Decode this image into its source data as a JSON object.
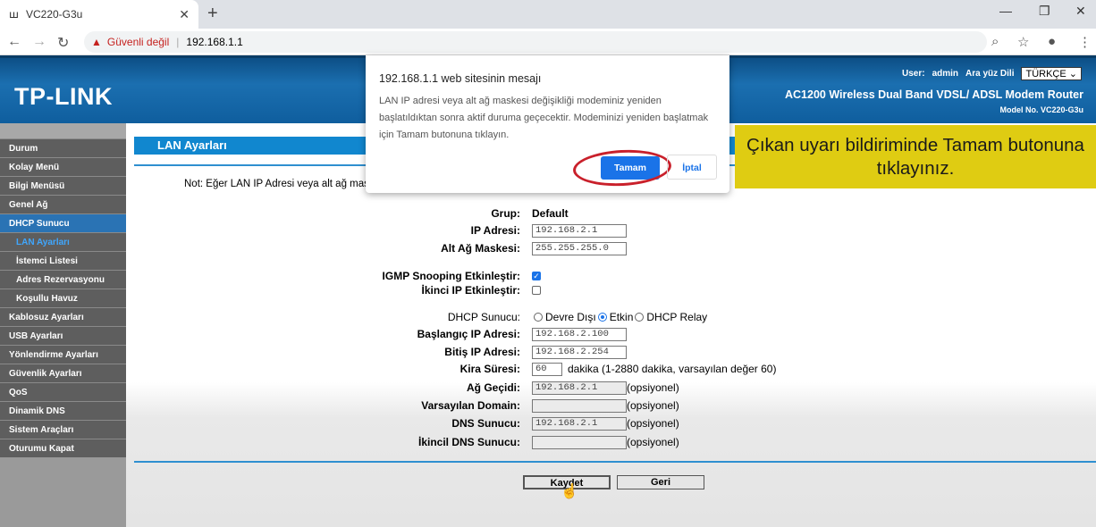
{
  "browser": {
    "tab_title": "VC220-G3u",
    "security": "Güvenli değil",
    "url": "192.168.1.1"
  },
  "header": {
    "logo": "TP-LINK",
    "user_label": "User:",
    "user": "admin",
    "lang_label": "Ara yüz Dili",
    "lang": "TÜRKÇE",
    "product": "AC1200 Wireless Dual Band VDSL/ ADSL Modem Router",
    "model": "Model No. VC220-G3u"
  },
  "sidebar": {
    "items": [
      {
        "label": "Durum"
      },
      {
        "label": "Kolay Menü"
      },
      {
        "label": "Bilgi Menüsü"
      },
      {
        "label": "Genel Ağ"
      },
      {
        "label": "DHCP Sunucu"
      },
      {
        "label": "LAN Ayarları"
      },
      {
        "label": "İstemci Listesi"
      },
      {
        "label": "Adres Rezervasyonu"
      },
      {
        "label": "Koşullu Havuz"
      },
      {
        "label": "Kablosuz Ayarları"
      },
      {
        "label": "USB Ayarları"
      },
      {
        "label": "Yönlendirme Ayarları"
      },
      {
        "label": "Güvenlik Ayarları"
      },
      {
        "label": "QoS"
      },
      {
        "label": "Dinamik DNS"
      },
      {
        "label": "Sistem Araçları"
      },
      {
        "label": "Oturumu Kapat"
      }
    ]
  },
  "main": {
    "title": "LAN Ayarları",
    "note": "Not: Eğer LAN IP Adresi veya alt ağ mas",
    "form": {
      "group_label": "Grup:",
      "group": "Default",
      "ip_label": "IP Adresi:",
      "ip": "192.168.2.1",
      "mask_label": "Alt Ağ Maskesi:",
      "mask": "255.255.255.0",
      "igmp_label": "IGMP Snooping Etkinleştir:",
      "igmp": true,
      "second_ip_label": "İkinci IP Etkinleştir:",
      "second_ip": false,
      "dhcp_label": "DHCP Sunucu:",
      "dhcp_options": [
        "Devre Dışı",
        "Etkin",
        "DHCP Relay"
      ],
      "dhcp_selected": "Etkin",
      "start_label": "Başlangıç IP Adresi:",
      "start": "192.168.2.100",
      "end_label": "Bitiş IP Adresi:",
      "end": "192.168.2.254",
      "lease_label": "Kira Süresi:",
      "lease": "60",
      "lease_hint": "dakika (1-2880 dakika, varsayılan değer 60)",
      "gw_label": "Ağ Geçidi:",
      "gw": "192.168.2.1",
      "domain_label": "Varsayılan Domain:",
      "domain": "",
      "dns_label": "DNS Sunucu:",
      "dns": "192.168.2.1",
      "dns2_label": "İkincil DNS Sunucu:",
      "dns2": "",
      "optional": "(opsiyonel)"
    },
    "save": "Kaydet",
    "back": "Geri"
  },
  "dialog": {
    "title": "192.168.1.1 web sitesinin mesajı",
    "message": "LAN IP adresi veya alt ağ maskesi değişikliği modeminiz yeniden başlatıldıktan sonra aktif duruma geçecektir. Modeminizi yeniden başlatmak için Tamam butonuna tıklayın.",
    "ok": "Tamam",
    "cancel": "İptal"
  },
  "callout": {
    "text": "Çıkan uyarı bildiriminde Tamam butonuna tıklayınız."
  }
}
